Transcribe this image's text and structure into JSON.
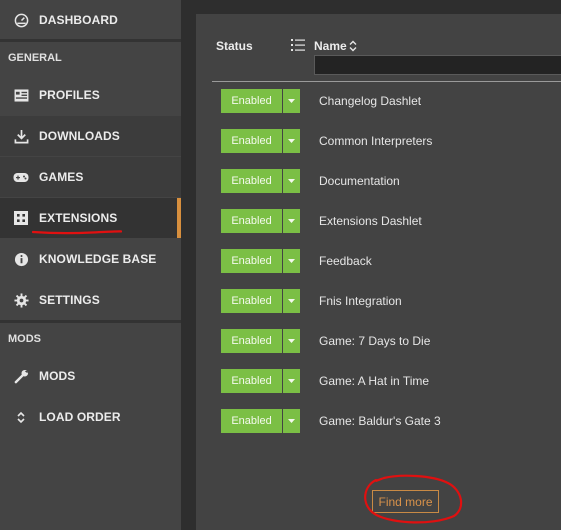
{
  "sidebar": {
    "dashboard_label": "DASHBOARD",
    "sections": {
      "general": "GENERAL",
      "mods": "MODS"
    },
    "items": [
      {
        "label": "PROFILES",
        "icon": "profile-card-icon"
      },
      {
        "label": "DOWNLOADS",
        "icon": "download-icon"
      },
      {
        "label": "GAMES",
        "icon": "gamepad-icon"
      },
      {
        "label": "EXTENSIONS",
        "icon": "extensions-grid-icon"
      },
      {
        "label": "KNOWLEDGE BASE",
        "icon": "info-icon"
      },
      {
        "label": "SETTINGS",
        "icon": "gear-icon"
      },
      {
        "label": "MODS",
        "icon": "wrench-icon"
      },
      {
        "label": "LOAD ORDER",
        "icon": "sort-arrows-icon"
      }
    ]
  },
  "table": {
    "status_header": "Status",
    "name_header": "Name",
    "filter_value": "",
    "rows": [
      {
        "status": "Enabled",
        "name": "Changelog Dashlet"
      },
      {
        "status": "Enabled",
        "name": "Common Interpreters"
      },
      {
        "status": "Enabled",
        "name": "Documentation"
      },
      {
        "status": "Enabled",
        "name": "Extensions Dashlet"
      },
      {
        "status": "Enabled",
        "name": "Feedback"
      },
      {
        "status": "Enabled",
        "name": "Fnis Integration"
      },
      {
        "status": "Enabled",
        "name": "Game: 7 Days to Die"
      },
      {
        "status": "Enabled",
        "name": "Game: A Hat in Time"
      },
      {
        "status": "Enabled",
        "name": "Game: Baldur's Gate 3"
      }
    ]
  },
  "find_more_label": "Find more",
  "colors": {
    "accent": "#d78f3e",
    "enabled_green": "#7bbf45",
    "annotation_red": "#e01010"
  }
}
